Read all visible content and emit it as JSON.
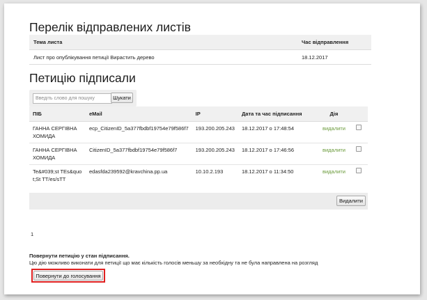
{
  "sent_letters": {
    "heading": "Перелік відправлених листів",
    "columns": [
      "Тема листа",
      "Час відправлення"
    ],
    "rows": [
      {
        "subject": "Лист про опублікування петиції Вирастить дерево",
        "sent_at": "18.12.2017"
      }
    ]
  },
  "signers": {
    "heading": "Петицію підписали",
    "search": {
      "placeholder": "Введіть слово для пошуку",
      "button_label": "Шукати"
    },
    "columns": [
      "ПІБ",
      "eMail",
      "IP",
      "Дата та час підписання",
      "Дія"
    ],
    "rows": [
      {
        "name": "ГАННА СЕРГІВНА ХОМИДА",
        "email": "ecp_CitizenID_5a377fbdbf19754e79f586f7",
        "ip": "193.200.205.243",
        "signed_at": "18.12.2017 о 17:48:54",
        "action": "видалити"
      },
      {
        "name": "ГАННА СЕРГІВНА ХОМИДА",
        "email": "CitizenID_5a377fbdbf19754e79f586f7",
        "ip": "193.200.205.243",
        "signed_at": "18.12.2017 о 17:46:56",
        "action": "видалити"
      },
      {
        "name": "Te&#039;st TEs&quot;St TT/es/sTT",
        "email": "edasfda239592@kravchina.pp.ua",
        "ip": "10.10.2.193",
        "signed_at": "18.12.2017 о 11:34:50",
        "action": "видалити"
      }
    ],
    "delete_button": "Видалити",
    "pagination": "1"
  },
  "return_section": {
    "title": "Повернути петицію у стан підписання.",
    "description": "Цю дію можливо виконати для петиції що має кількість голосів меньшу за необхідну та не була направлена на розгляд",
    "button_label": "Повернути до голосування"
  },
  "colors": {
    "delete_link": "#6a9a3a",
    "highlight": "#e02020"
  }
}
